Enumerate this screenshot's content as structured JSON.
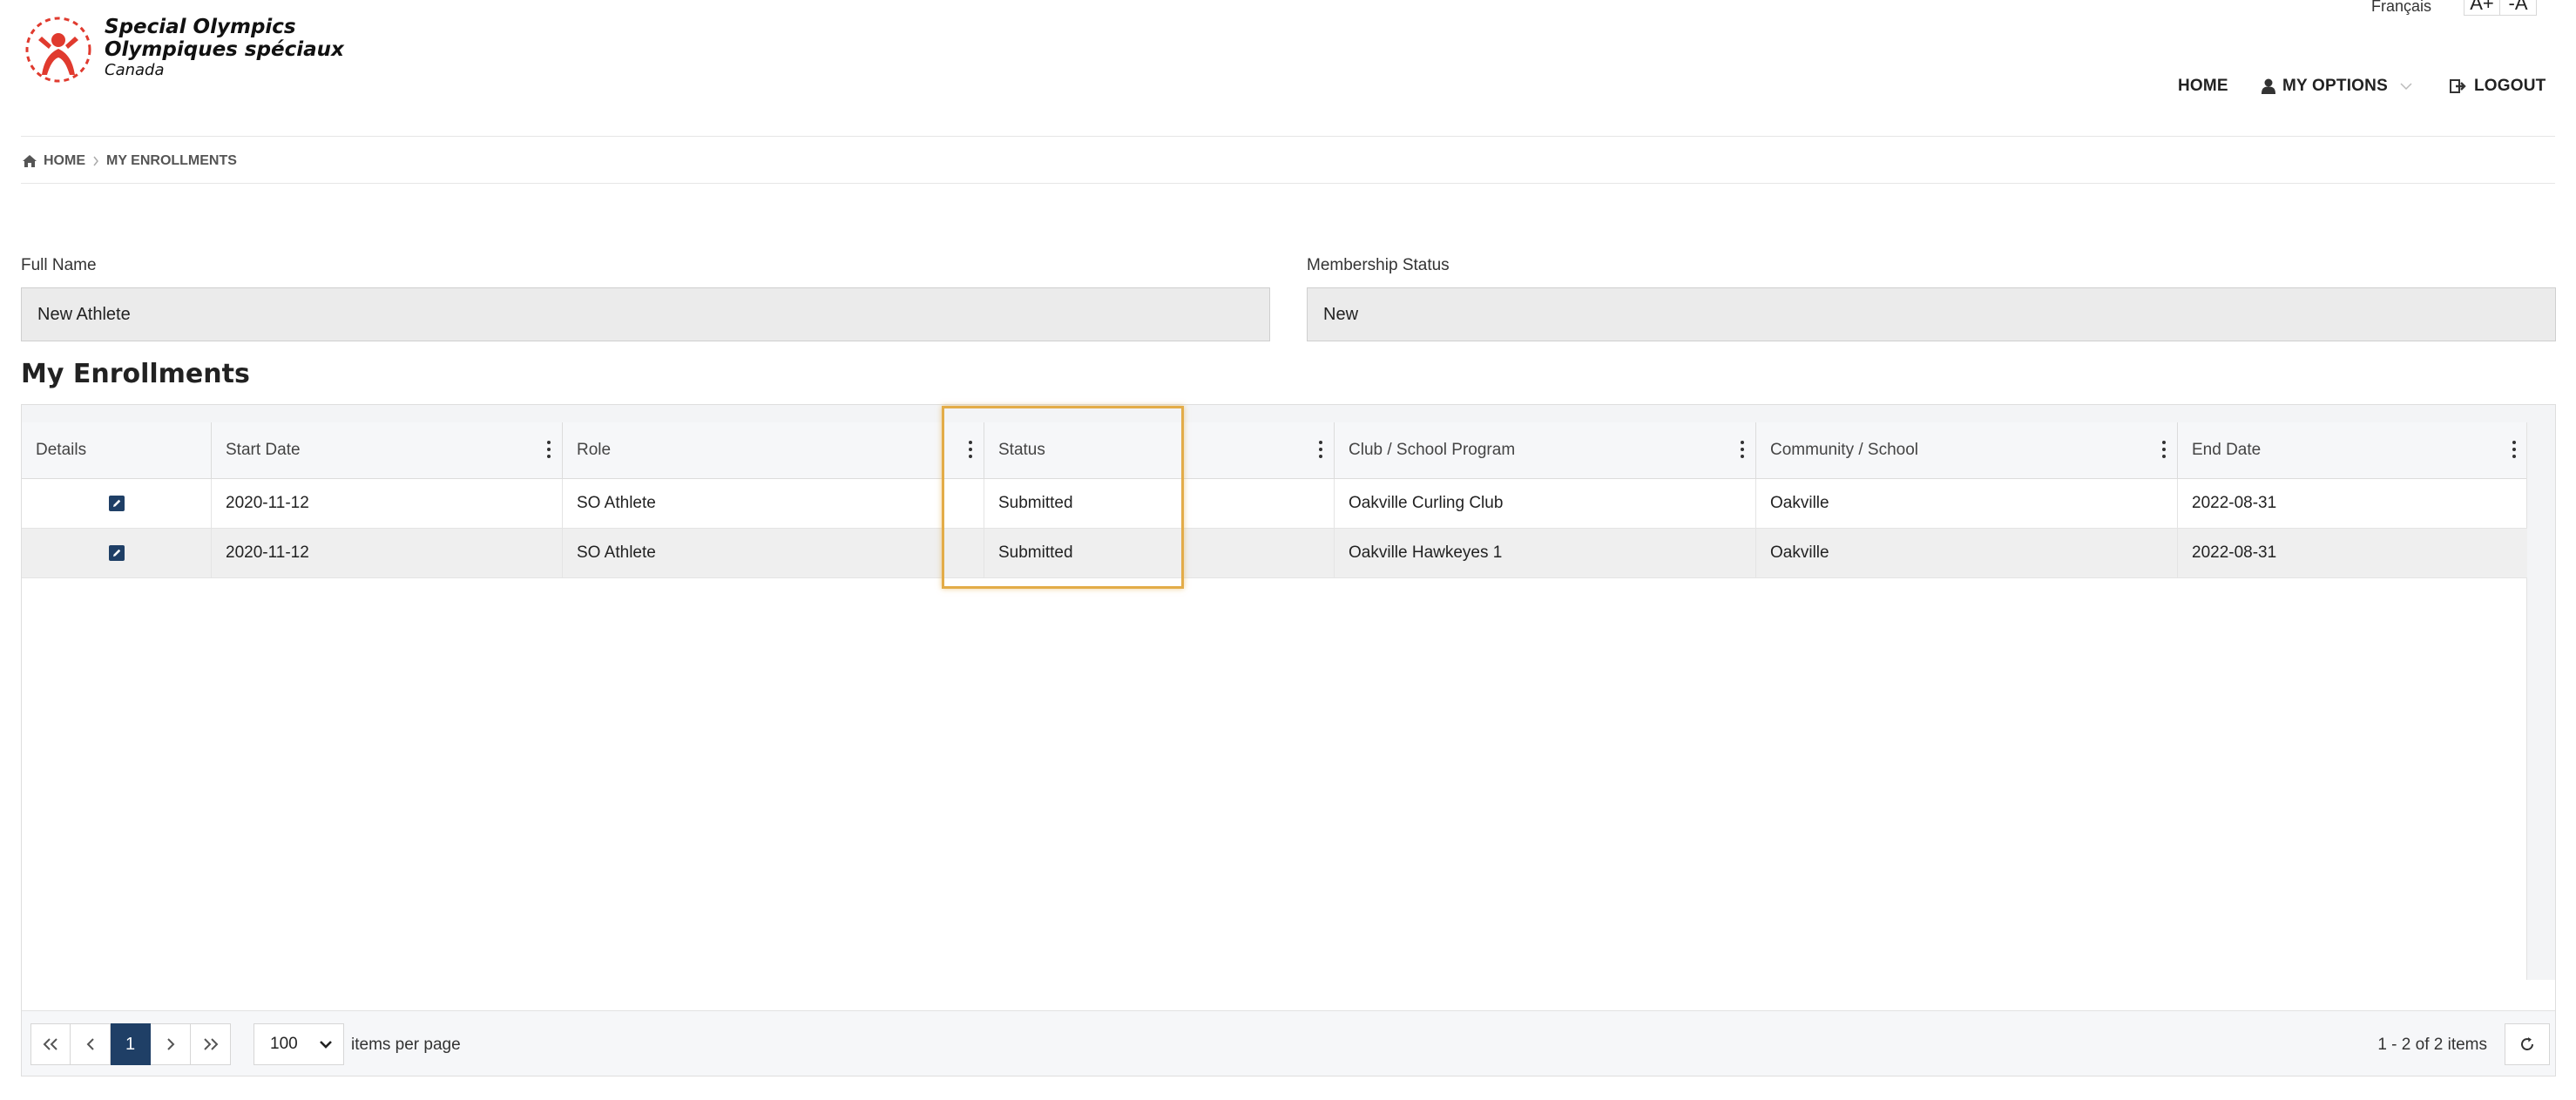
{
  "header": {
    "logo_line1": "Special Olympics",
    "logo_line2": "Olympiques spéciaux",
    "logo_line3": "Canada",
    "language": "Français",
    "font_increase": "A+",
    "font_decrease": "-A",
    "nav": {
      "home": "HOME",
      "my_options": "MY OPTIONS",
      "logout": "LOGOUT"
    },
    "logo_color": "#e03a2e"
  },
  "breadcrumb": {
    "home": "HOME",
    "current": "MY ENROLLMENTS"
  },
  "form": {
    "full_name_label": "Full Name",
    "full_name_value": "New Athlete",
    "membership_label": "Membership Status",
    "membership_value": "New"
  },
  "section_title": "My Enrollments",
  "grid": {
    "columns": [
      "Details",
      "Start Date",
      "Role",
      "Status",
      "Club / School Program",
      "Community / School",
      "End Date"
    ],
    "rows": [
      {
        "start_date": "2020-11-12",
        "role": "SO Athlete",
        "status": "Submitted",
        "club": "Oakville Curling Club",
        "community": "Oakville",
        "end_date": "2022-08-31"
      },
      {
        "start_date": "2020-11-12",
        "role": "SO Athlete",
        "status": "Submitted",
        "club": "Oakville Hawkeyes 1",
        "community": "Oakville",
        "end_date": "2022-08-31"
      }
    ],
    "pager": {
      "current_page": "1",
      "page_size": "100",
      "items_per_page_label": "items per page",
      "count_text": "1 - 2 of 2 items"
    },
    "accent_color": "#1f3f66",
    "highlight_color": "#e3ac48"
  }
}
